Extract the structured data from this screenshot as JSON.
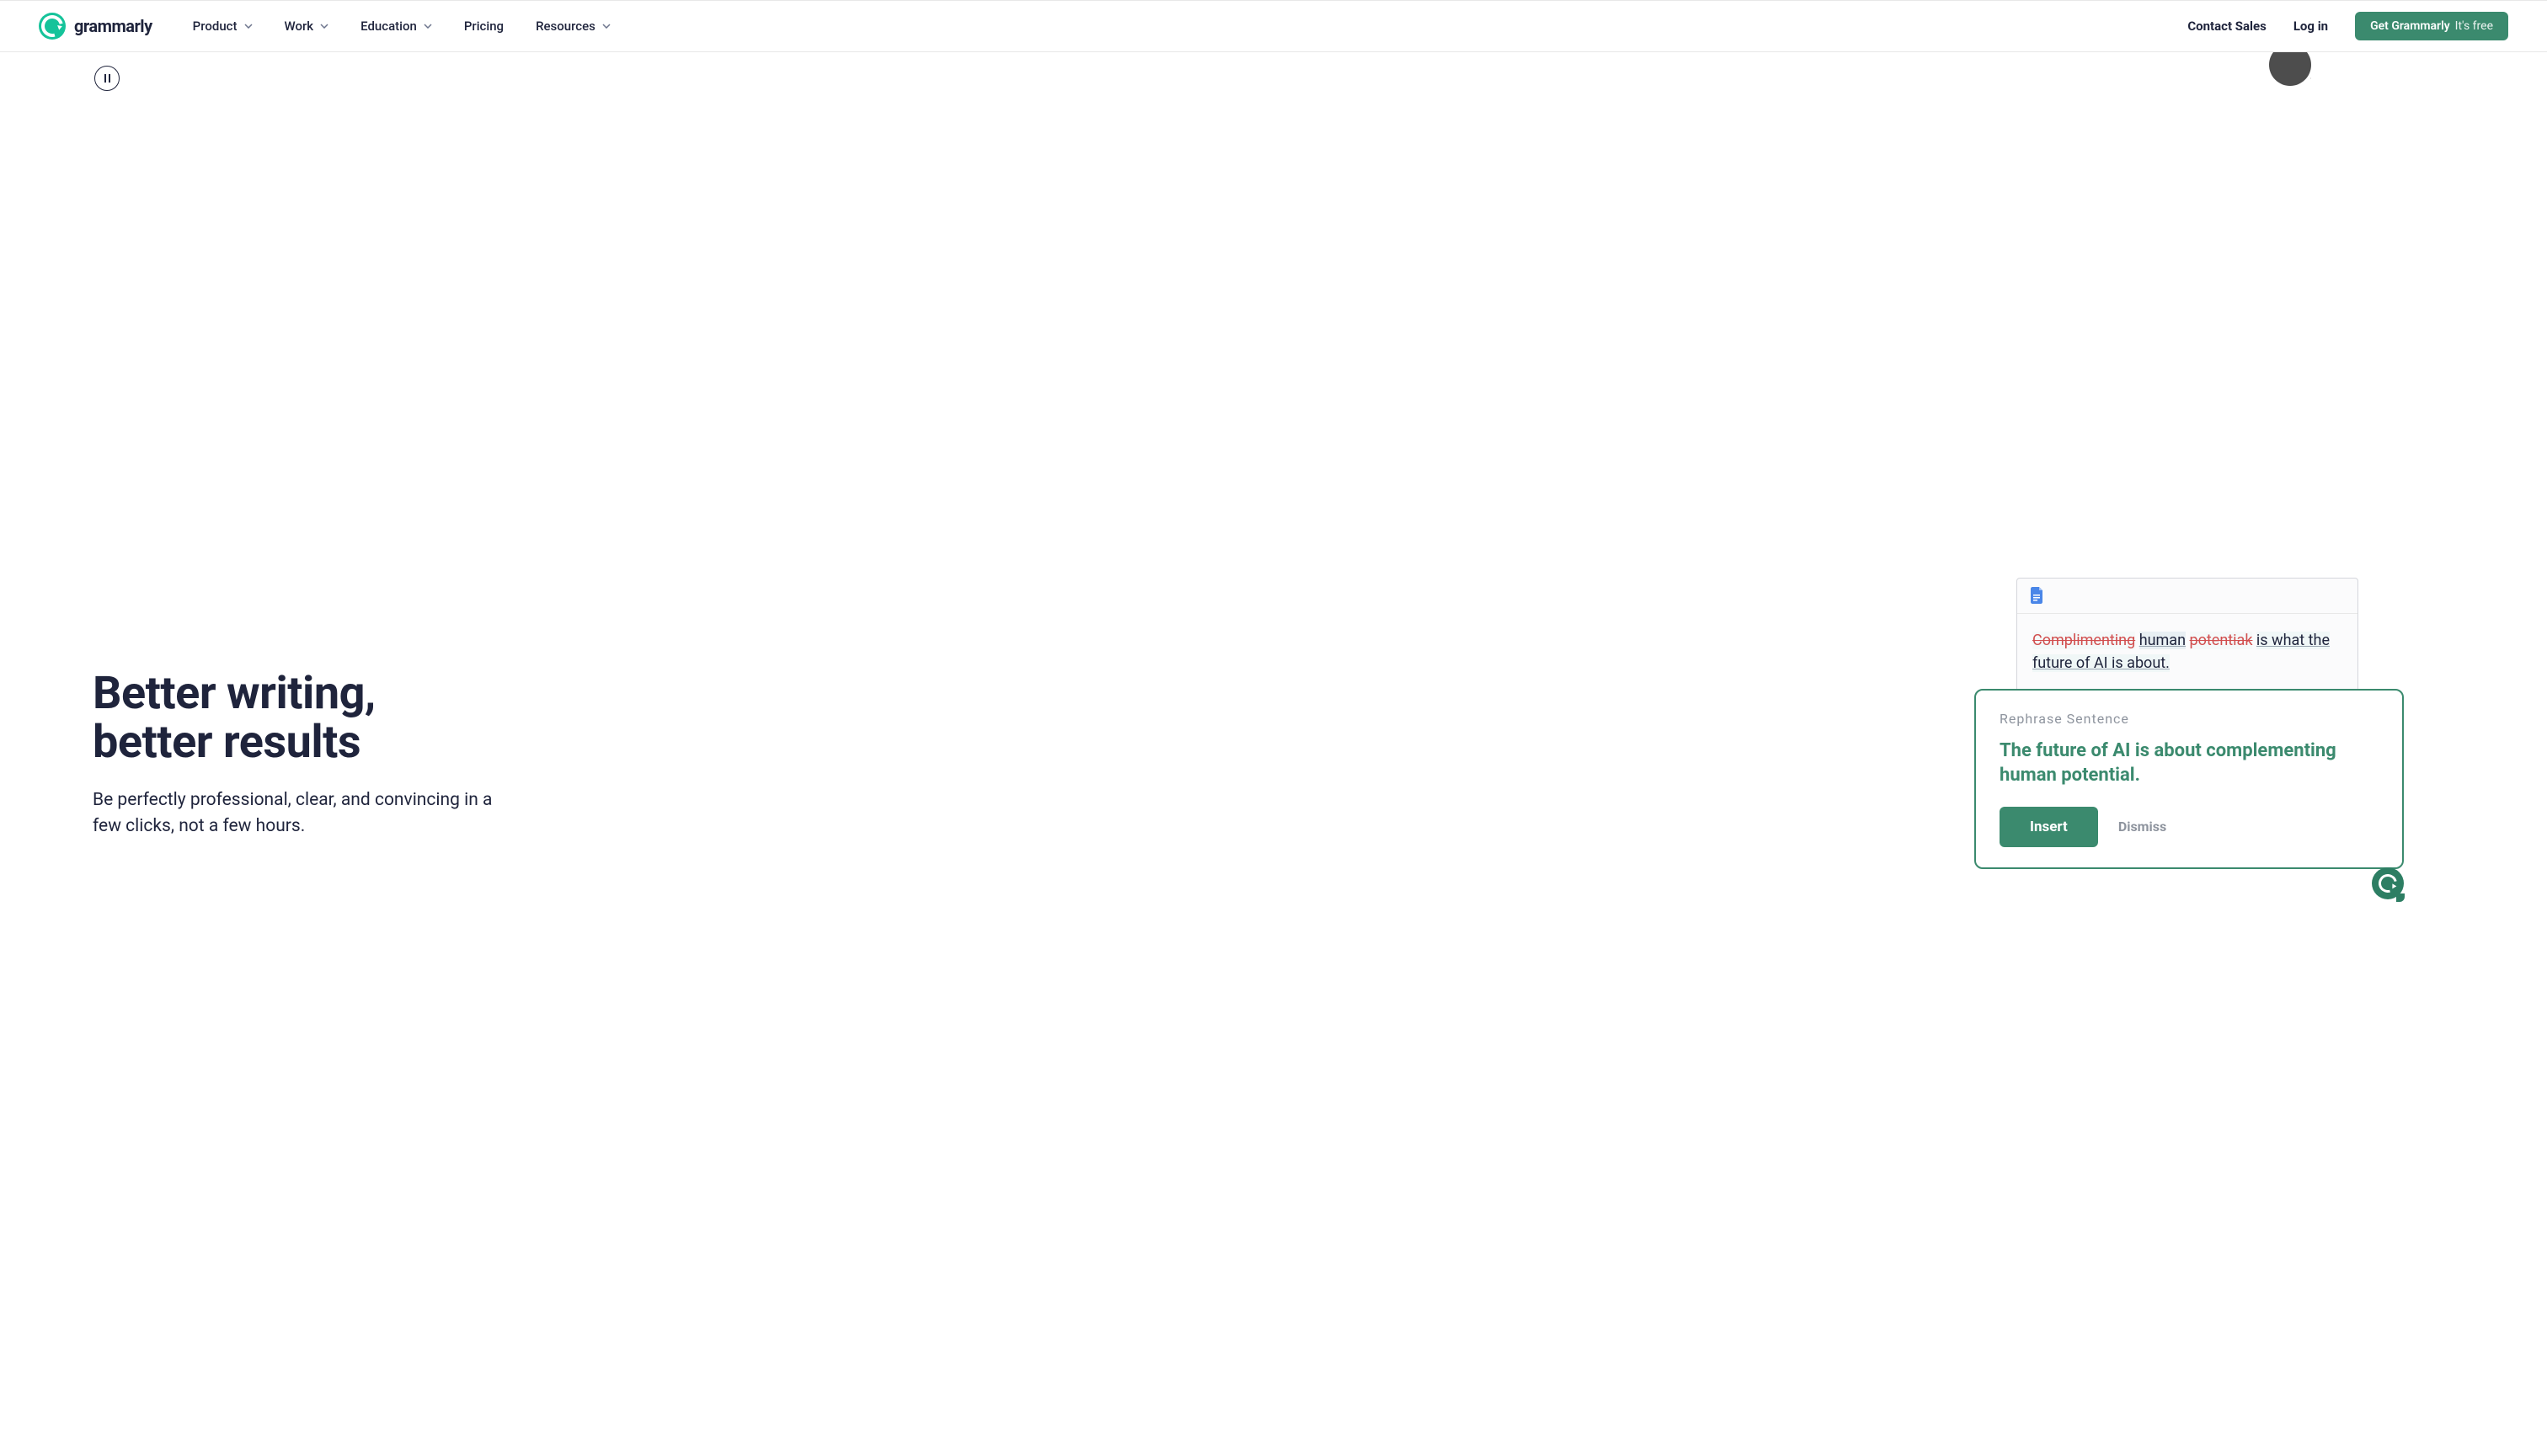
{
  "brand": {
    "name": "grammarly"
  },
  "nav": {
    "items": [
      {
        "label": "Product",
        "has_dropdown": true
      },
      {
        "label": "Work",
        "has_dropdown": true
      },
      {
        "label": "Education",
        "has_dropdown": true
      },
      {
        "label": "Pricing",
        "has_dropdown": false
      },
      {
        "label": "Resources",
        "has_dropdown": true
      }
    ],
    "contact_sales": "Contact Sales",
    "login": "Log in",
    "cta_main": "Get Grammarly",
    "cta_sub": "It's free"
  },
  "hero": {
    "title_line1": "Better writing,",
    "title_line2": "better results",
    "subtitle": "Be perfectly professional, clear, and convincing in a few clicks, not a few hours."
  },
  "editor": {
    "strike1": "Complimenting",
    "word_human": "human",
    "strike2": "potentiak",
    "rest": "is what the future of AI is about."
  },
  "suggestion": {
    "label": "Rephrase Sentence",
    "text": "The future of AI is about complementing human potential.",
    "insert": "Insert",
    "dismiss": "Dismiss"
  },
  "colors": {
    "brand_green": "#15c39a",
    "accent_green": "#3b8a6e",
    "dark_text": "#1f243c",
    "strike_red": "#d14e4e"
  }
}
